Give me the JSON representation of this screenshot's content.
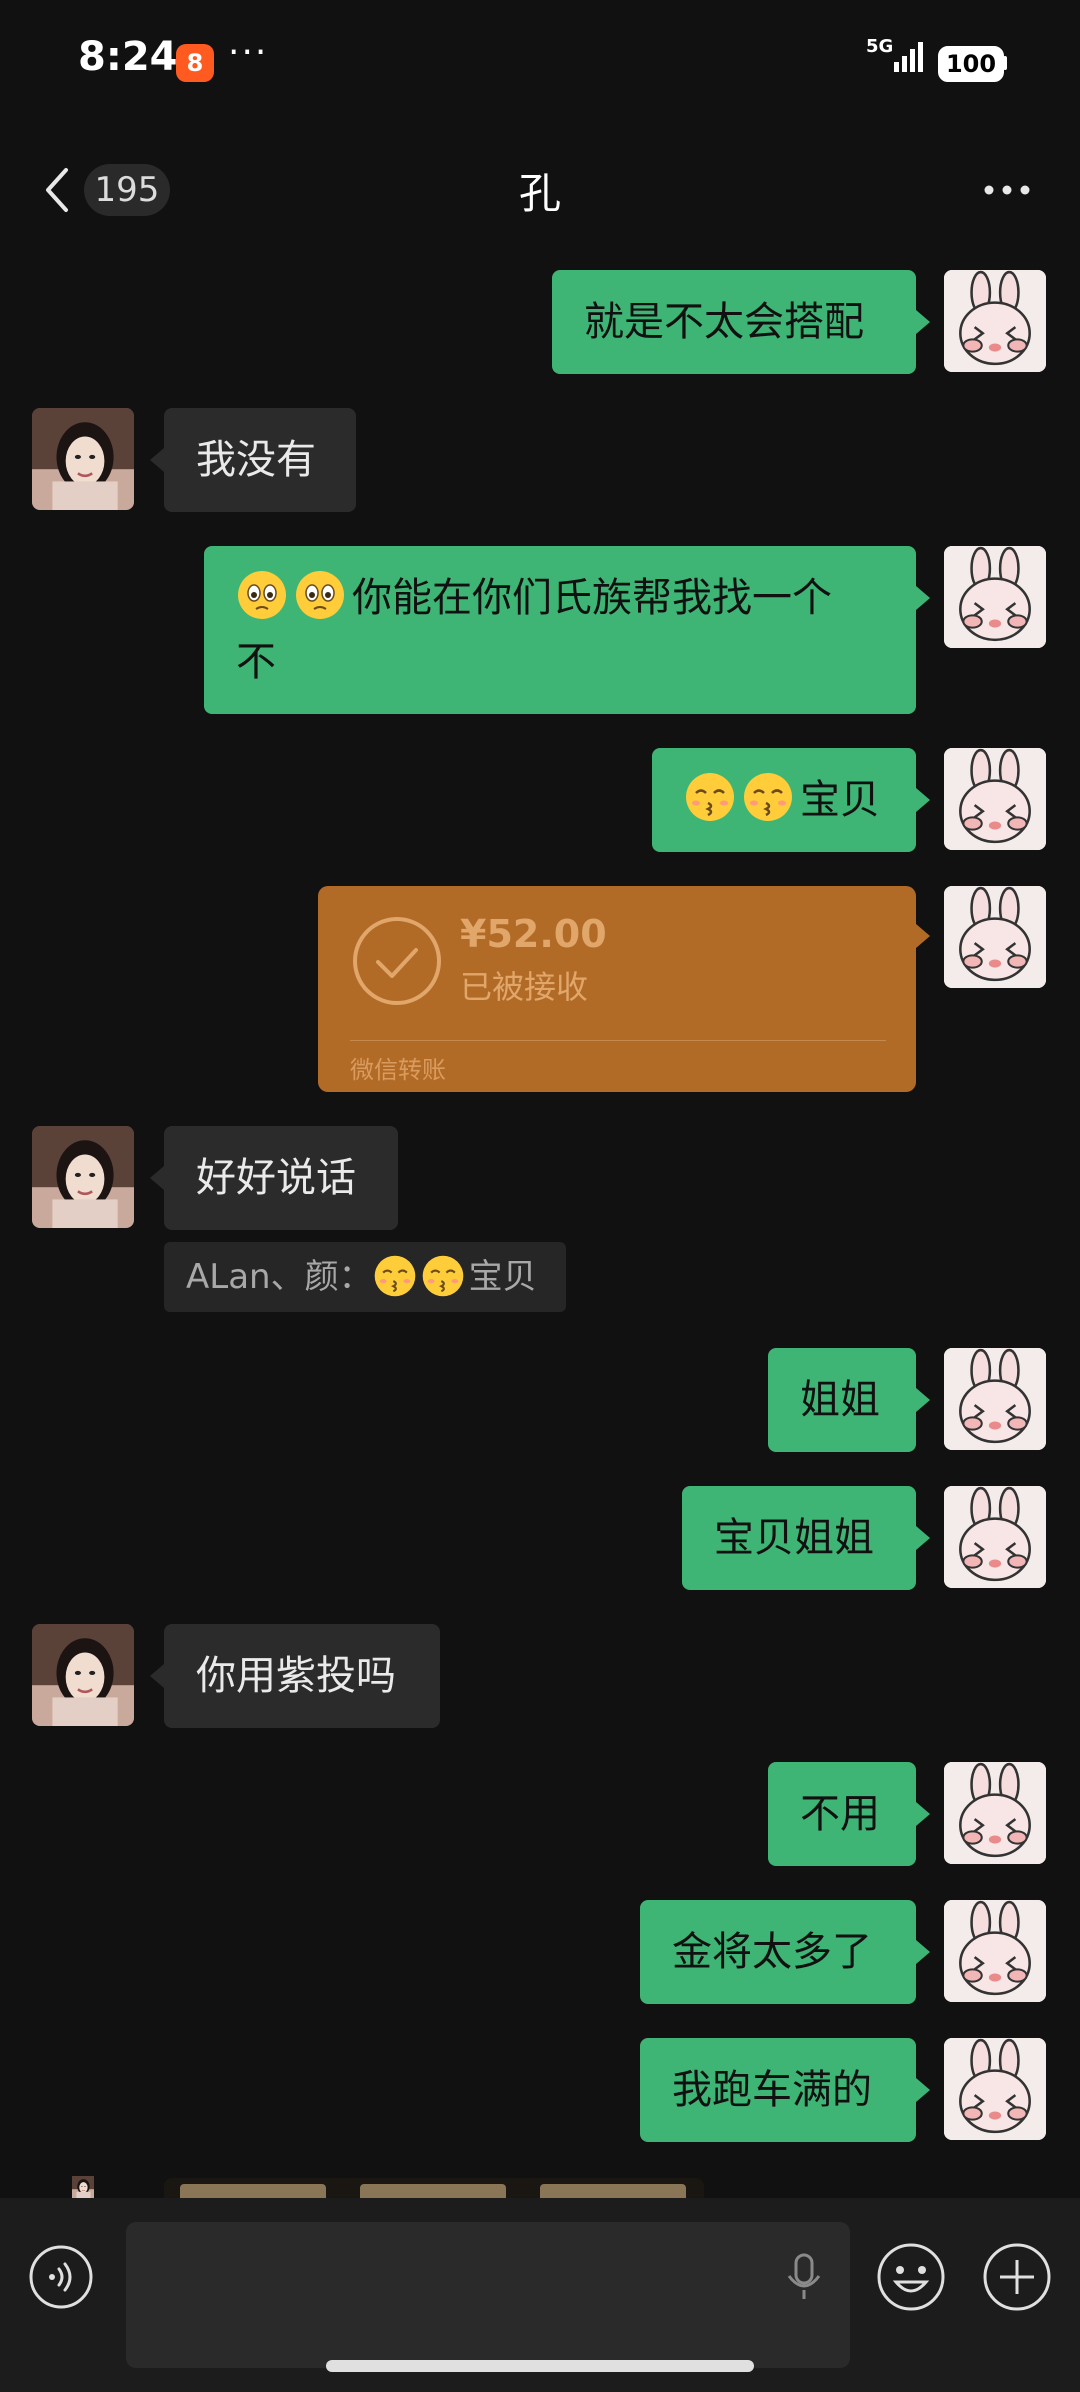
{
  "status_bar": {
    "time": "8:24",
    "app_badge": "8",
    "dots": "···",
    "network": "5G",
    "battery": "100"
  },
  "nav": {
    "unread_count": "195",
    "title": "孔"
  },
  "messages": [
    {
      "text": "就是不太会搭配"
    },
    {
      "text": "我没有"
    },
    {
      "line1": "你能在你们氏族帮我找一个",
      "line2": "不"
    },
    {
      "text": "宝贝"
    },
    {
      "amount": "¥52.00",
      "status": "已被接收",
      "label": "微信转账"
    },
    {
      "text": "好好说话",
      "quote_prefix": "ALan、颜：",
      "quote_text": "宝贝"
    },
    {
      "text": "姐姐"
    },
    {
      "text": "宝贝姐姐"
    },
    {
      "text": "你用紫投吗"
    },
    {
      "text": "不用"
    },
    {
      "text": "金将太多了"
    },
    {
      "text": "我跑车满的"
    }
  ],
  "colors": {
    "bubble_me": "#3eb575",
    "bubble_her": "#2b2b2b",
    "transfer": "#b26b27",
    "background": "#111111"
  },
  "icons": [
    "back-chevron-icon",
    "more-icon",
    "voice-icon",
    "mic-icon",
    "emoji-face-icon",
    "plus-icon"
  ]
}
